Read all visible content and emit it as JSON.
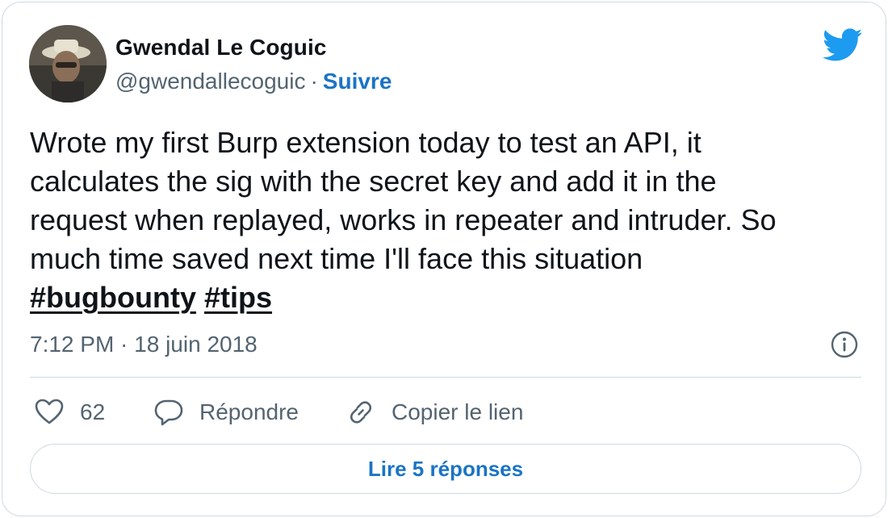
{
  "author": {
    "name": "Gwendal Le Coguic",
    "handle": "@gwendallecoguic",
    "separator": "·",
    "follow_label": "Suivre"
  },
  "tweet": {
    "text": "Wrote my first Burp extension today to test an API, it\ncalculates the sig with the secret key and  add it in the\nrequest when replayed, works in repeater and intruder. So\nmuch time saved next time I'll face this situation",
    "hashtags": [
      "#bugbounty",
      "#tips"
    ],
    "timestamp": "7:12 PM · 18 juin 2018"
  },
  "actions": {
    "like_count": "62",
    "reply_label": "Répondre",
    "copy_link_label": "Copier le lien"
  },
  "replies_button_label": "Lire 5 réponses",
  "icons": {
    "brand": "twitter-bird-icon",
    "info": "info-icon",
    "like": "heart-icon",
    "reply": "speech-bubble-icon",
    "copy": "link-icon"
  },
  "colors": {
    "accent": "#1b74c5",
    "twitter_blue": "#1d9bf0",
    "text": "#0f1419",
    "muted": "#536471",
    "border": "#cfd9de"
  }
}
